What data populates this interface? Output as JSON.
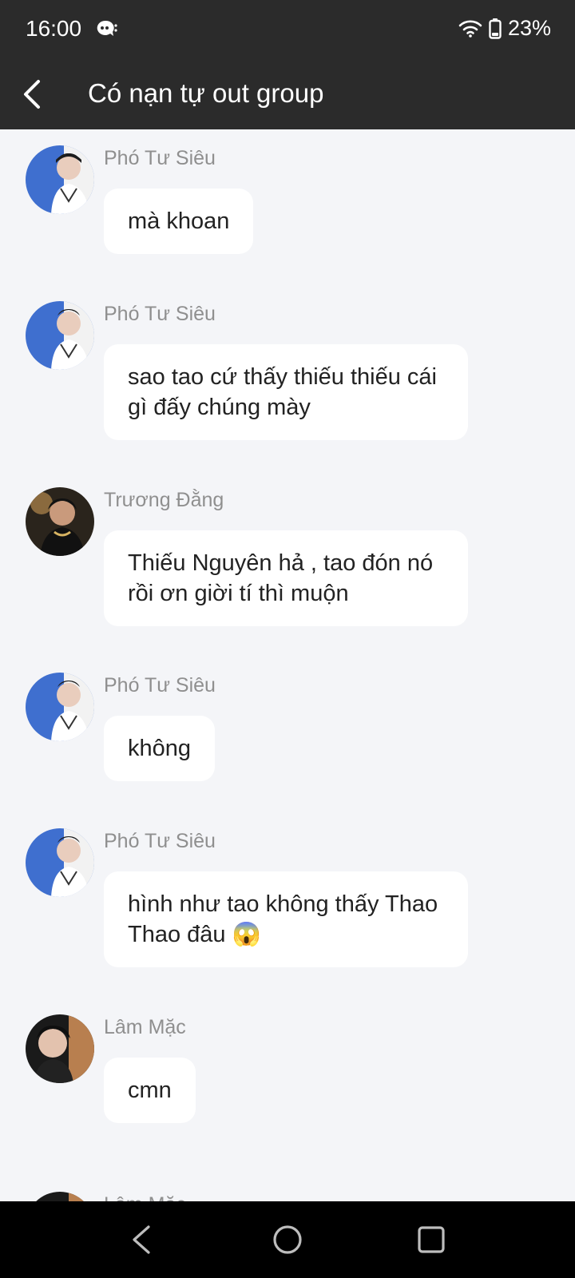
{
  "status_bar": {
    "time": "16:00",
    "notification_icon": "message-bubble-icon",
    "wifi_icon": "wifi-icon",
    "battery_icon": "battery-icon",
    "battery_percent": "23%"
  },
  "header": {
    "back_icon": "chevron-left-icon",
    "title": "Có nạn tự out group"
  },
  "messages": [
    {
      "sender": "Phó Tư Siêu",
      "text": "mà khoan",
      "avatar": "avatar-pho-tu-sieu"
    },
    {
      "sender": "Phó Tư Siêu",
      "text": "sao tao cứ thấy thiếu thiếu cái gì đấy chúng mày",
      "avatar": "avatar-pho-tu-sieu"
    },
    {
      "sender": "Trương Đằng",
      "text": "Thiếu Nguyên hả , tao đón nó rồi ơn giời tí thì muộn",
      "avatar": "avatar-truong-dang"
    },
    {
      "sender": "Phó Tư Siêu",
      "text": "không",
      "avatar": "avatar-pho-tu-sieu"
    },
    {
      "sender": "Phó Tư Siêu",
      "text": "hình như tao không thấy Thao Thao đâu 😱",
      "avatar": "avatar-pho-tu-sieu"
    },
    {
      "sender": "Lâm Mặc",
      "text": "cmn",
      "avatar": "avatar-lam-mac"
    },
    {
      "sender": "Lâm Mặc",
      "text": "",
      "avatar": "avatar-lam-mac"
    }
  ],
  "nav_bar": {
    "back_icon": "triangle-back-icon",
    "home_icon": "circle-home-icon",
    "recents_icon": "square-recents-icon"
  }
}
